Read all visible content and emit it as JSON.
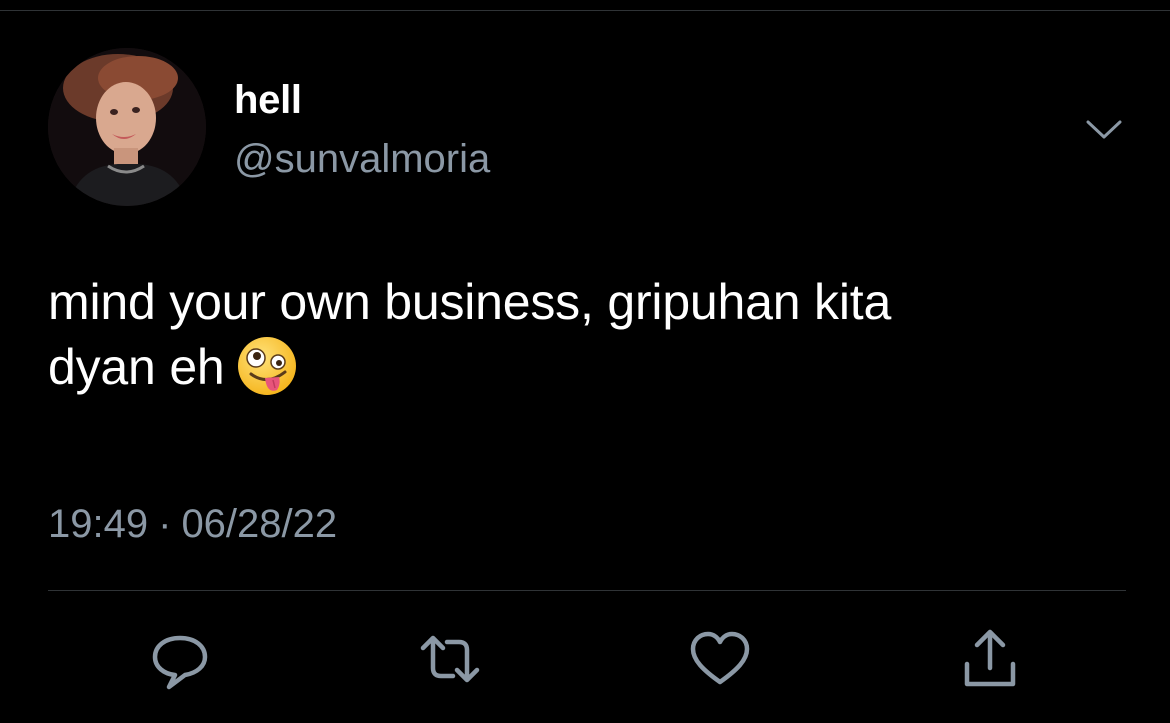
{
  "tweet": {
    "author": {
      "display_name": "hell",
      "handle": "@sunvalmoria",
      "avatar_icon": "profile-photo"
    },
    "text_line1": "mind your own business, gripuhan kita",
    "text_line2": "dyan eh",
    "emoji": "zany-face",
    "time": "19:49",
    "separator": "·",
    "date": "06/28/22",
    "menu_icon": "chevron-down-icon"
  },
  "actions": [
    {
      "name": "reply",
      "icon": "speech-bubble-icon"
    },
    {
      "name": "retweet",
      "icon": "retweet-icon"
    },
    {
      "name": "like",
      "icon": "heart-icon"
    },
    {
      "name": "share",
      "icon": "share-icon"
    }
  ],
  "colors": {
    "background": "#000000",
    "primary_text": "#ffffff",
    "secondary_text": "#8b98a5",
    "divider": "#2f3336"
  }
}
